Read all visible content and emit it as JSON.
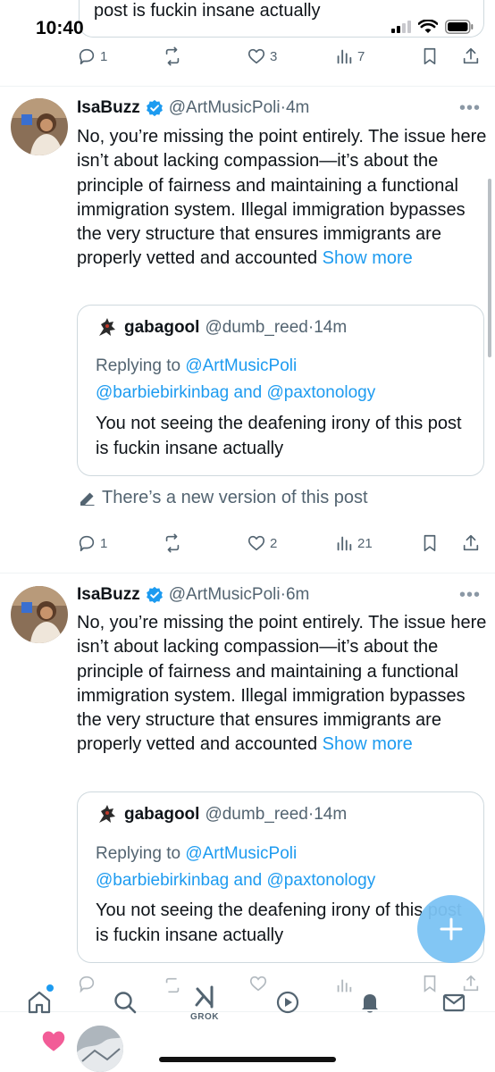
{
  "status_bar": {
    "time": "10:40"
  },
  "top_quote": {
    "text": "post is fuckin insane actually"
  },
  "top_actions": {
    "replies": "1",
    "reposts": "",
    "likes": "3",
    "views": "7"
  },
  "tweets": [
    {
      "name": "IsaBuzz",
      "handle": "@ArtMusicPoli",
      "dot": "·",
      "time": "4m",
      "more": "•••",
      "body": "No, you’re missing the point entirely. The issue here isn’t about lacking compassion—it’s about the principle of fairness and maintaining a functional immigration system. Illegal immigration bypasses the very structure that ensures immigrants are properly vetted and accounted",
      "show_more": "Show more",
      "quote": {
        "name": "gabagool",
        "handle": "@dumb_reed",
        "dot": "·",
        "time": "14m",
        "replying_prefix": "Replying to",
        "mention_1": "@ArtMusicPoli",
        "mention_2": "@barbiebirkinbag",
        "and_word": "and",
        "mention_3": "@paxtonology",
        "text": "You not seeing the deafening irony of this post is fuckin insane actually"
      },
      "new_version": "There’s a new version of this post",
      "actions": {
        "replies": "1",
        "reposts": "",
        "likes": "2",
        "views": "21"
      }
    },
    {
      "name": "IsaBuzz",
      "handle": "@ArtMusicPoli",
      "dot": "·",
      "time": "6m",
      "more": "•••",
      "body": "No, you’re missing the point entirely. The issue here isn’t about lacking compassion—it’s about the principle of fairness and maintaining a functional immigration system. Illegal immigration bypasses the very structure that ensures immigrants are properly vetted and accounted",
      "show_more": "Show more",
      "quote": {
        "name": "gabagool",
        "handle": "@dumb_reed",
        "dot": "·",
        "time": "14m",
        "replying_prefix": "Replying to",
        "mention_1": "@ArtMusicPoli",
        "mention_2": "@barbiebirkinbag",
        "and_word": "and",
        "mention_3": "@paxtonology",
        "text": "You not seeing the deafening irony of this post is fuckin insane actually"
      }
    }
  ],
  "tabbar": {
    "grok_label": "GROK",
    "icons": [
      "home-icon",
      "search-icon",
      "grok-icon",
      "video-icon",
      "notifications-icon",
      "messages-icon"
    ]
  },
  "colors": {
    "accent": "#1d9bf0",
    "text": "#0f1419",
    "secondary": "#536471",
    "border": "#cfd9de",
    "fab": "#7cc3f4",
    "heart": "#f25c97"
  }
}
